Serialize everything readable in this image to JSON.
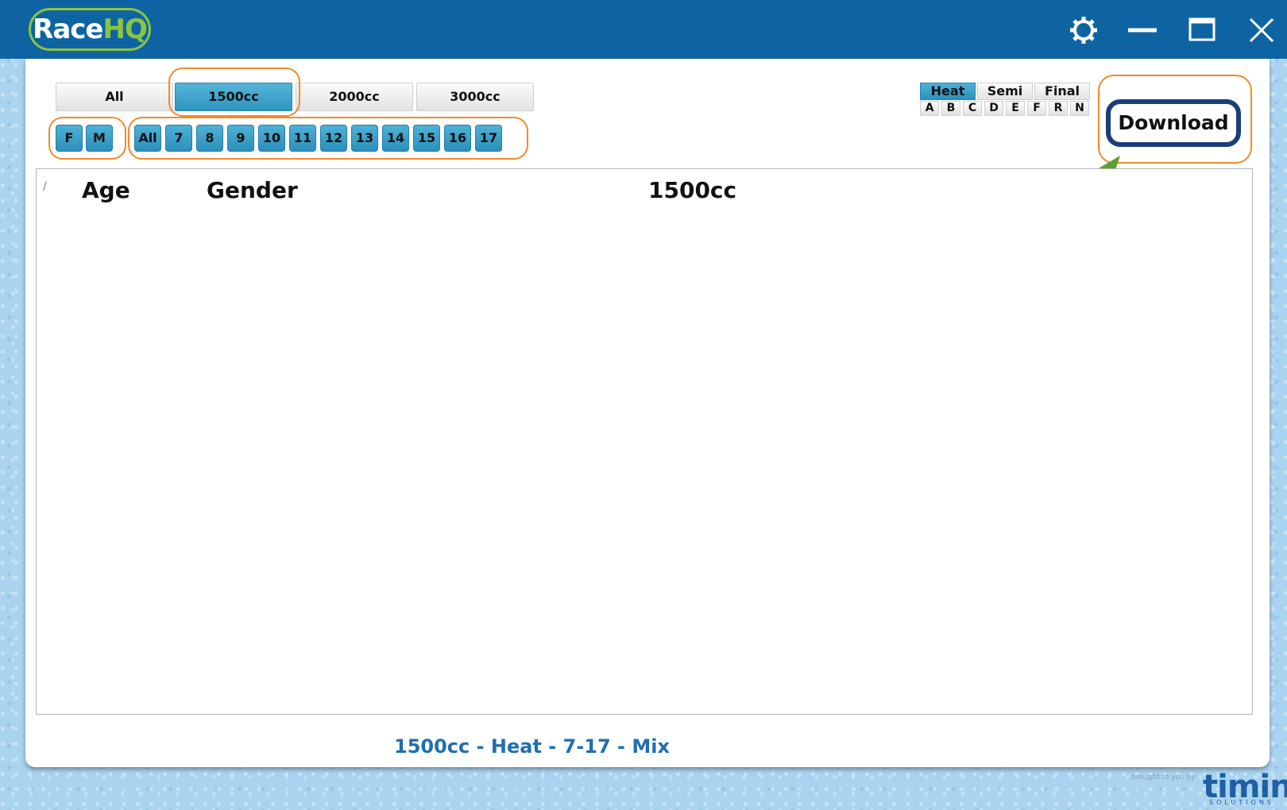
{
  "app": {
    "logo_race": "Race",
    "logo_hq": "HQ"
  },
  "window_controls": {
    "settings": "gear-icon",
    "minimize": "minimize-icon",
    "maximize": "maximize-icon",
    "close": "close-icon"
  },
  "class_tabs": [
    "All",
    "1500cc",
    "2000cc",
    "3000cc"
  ],
  "selected_class": "1500cc",
  "gender_buttons": [
    "F",
    "M"
  ],
  "age_buttons": [
    "All",
    "7",
    "8",
    "9",
    "10",
    "11",
    "12",
    "13",
    "14",
    "15",
    "16",
    "17"
  ],
  "round_tabs": [
    "Heat",
    "Semi",
    "Final"
  ],
  "selected_round": "Heat",
  "round_letters": [
    "A",
    "B",
    "C",
    "D",
    "E",
    "F",
    "R",
    "N"
  ],
  "download_label": "Download",
  "results_table": {
    "sort_marker": "/",
    "headers": {
      "age": "Age",
      "gender": "Gender",
      "class": "1500cc"
    }
  },
  "caption": "1500cc - Heat - 7-17 - Mix",
  "brand": {
    "small": "brought to you by",
    "name": "timing",
    "sub": "SOLUTIONS"
  },
  "colors": {
    "titlebar": "#0e64a3",
    "accent_blue": "#2f95c0",
    "highlight_ring": "#ef8a2c",
    "arrow_green": "#5aa02c",
    "download_border": "#1b3e78"
  }
}
